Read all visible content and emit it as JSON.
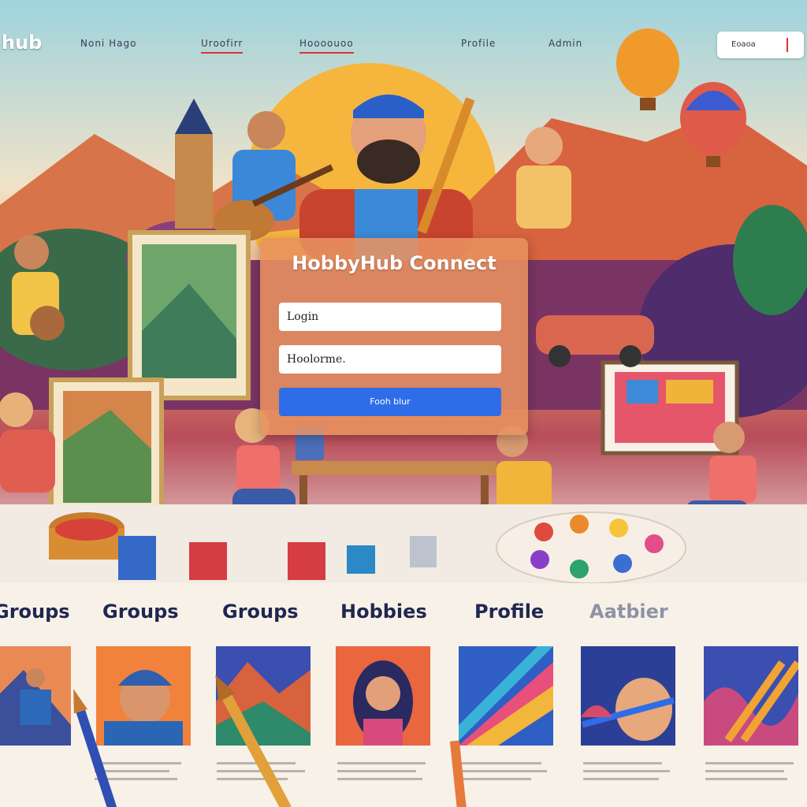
{
  "nav": {
    "brand": "hub",
    "links": [
      "Noni Hago",
      "Uroofirr",
      "Hoooouoo",
      "Profile",
      "Admin"
    ],
    "search_value": "Eoaoa"
  },
  "login": {
    "title": "HobbyHub Connect",
    "username_placeholder": "Login",
    "password_placeholder": "Hoolorme.",
    "button_label": "Fooh blur"
  },
  "categories": {
    "tabs": [
      "Groups",
      "Groups",
      "Groups",
      "Hobbies",
      "Profile",
      "Aatbier"
    ]
  },
  "colors": {
    "accent": "#2f6de8",
    "heading": "#1f2750",
    "card_orange": "#e98a55"
  }
}
